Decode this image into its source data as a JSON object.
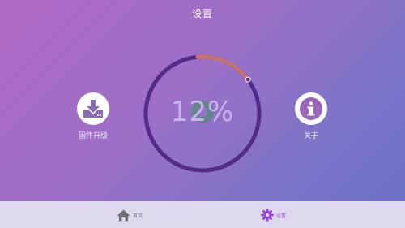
{
  "header": {
    "title": "设置"
  },
  "progress": {
    "percent_text": "12%",
    "value": 0.12,
    "track_color": "#532c8a",
    "fill_color": "#c4736e"
  },
  "firmware": {
    "label": "固件升级",
    "icon": "firmware-download-icon"
  },
  "about": {
    "label": "关于",
    "icon": "info-icon"
  },
  "nav": {
    "items": [
      {
        "label": "首页",
        "icon": "home-icon",
        "active": false
      },
      {
        "label": "设置",
        "icon": "gear-icon",
        "active": true
      }
    ]
  },
  "colors": {
    "accent": "#9a43d8",
    "bottom_bar": "#dfd9ef"
  }
}
